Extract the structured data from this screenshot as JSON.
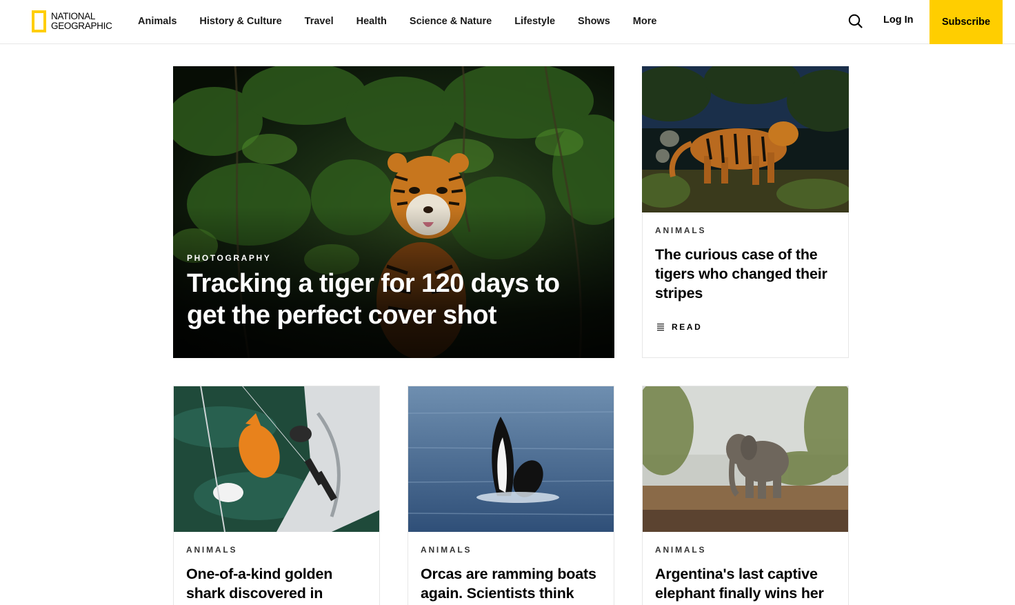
{
  "header": {
    "logo_line1": "NATIONAL",
    "logo_line2": "GEOGRAPHIC",
    "nav": [
      "Animals",
      "History & Culture",
      "Travel",
      "Health",
      "Science & Nature",
      "Lifestyle",
      "Shows",
      "More"
    ],
    "login": "Log In",
    "subscribe": "Subscribe"
  },
  "hero": {
    "kicker": "PHOTOGRAPHY",
    "title": "Tracking a tiger for 120 days to get the perfect cover shot"
  },
  "side_card": {
    "kicker": "ANIMALS",
    "title": "The curious case of the tigers who changed their stripes",
    "action": "READ"
  },
  "cards": [
    {
      "kicker": "ANIMALS",
      "title": "One-of-a-kind golden shark discovered in"
    },
    {
      "kicker": "ANIMALS",
      "title": "Orcas are ramming boats again. Scientists think"
    },
    {
      "kicker": "ANIMALS",
      "title": "Argentina's last captive elephant finally wins her"
    }
  ],
  "colors": {
    "brand_yellow": "#ffce00",
    "border": "#e6e6e6"
  },
  "icons": {
    "search": "search-icon",
    "read": "text-lines-icon"
  }
}
